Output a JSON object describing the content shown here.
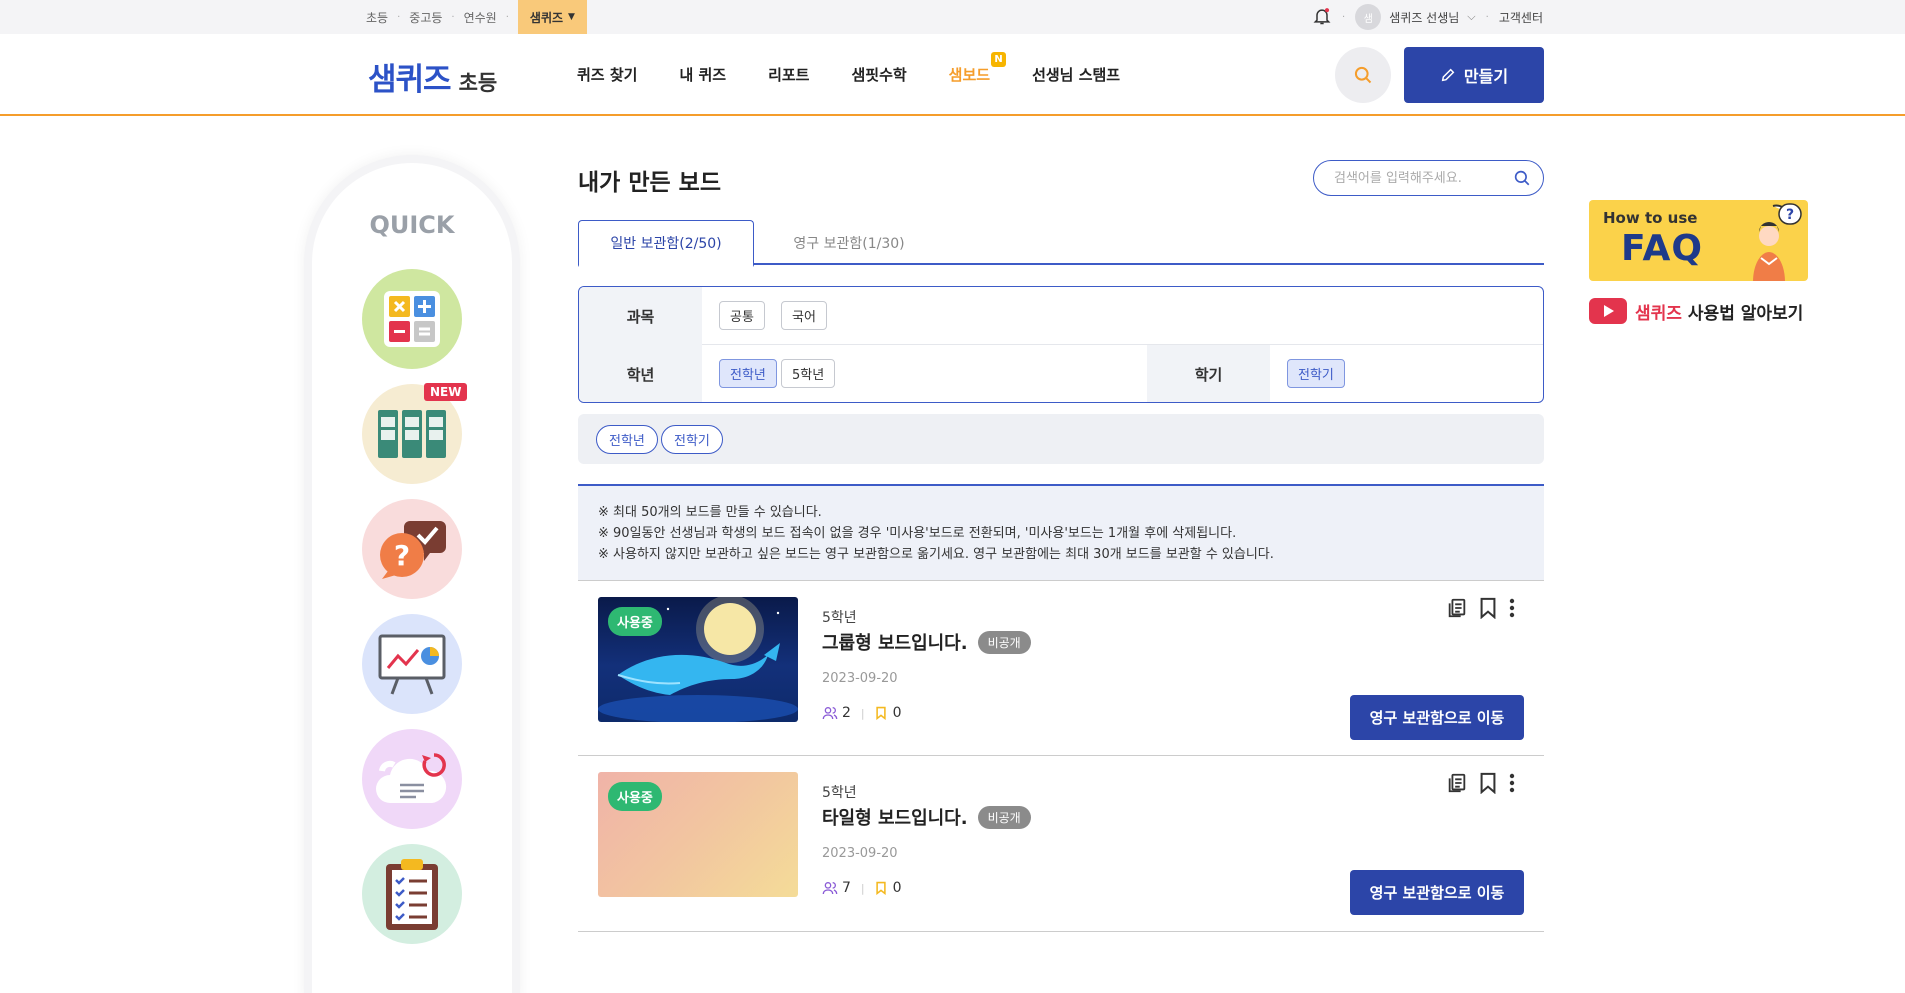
{
  "topbar": {
    "links": [
      "초등",
      "중고등",
      "연수원"
    ],
    "active_link": "샘퀴즈",
    "user_avatar_initial": "샘",
    "user_name": "샘퀴즈 선생님",
    "support": "고객센터"
  },
  "header": {
    "brand": "샘퀴즈",
    "brand_sub": "초등",
    "nav": [
      "퀴즈 찾기",
      "내 퀴즈",
      "리포트",
      "샘핏수학",
      "샘보드",
      "선생님 스탬프"
    ],
    "nav_badge": "N",
    "create_label": "만들기"
  },
  "quick": {
    "title": "QUICK",
    "new_label": "NEW"
  },
  "main": {
    "title": "내가 만든 보드",
    "search_placeholder": "검색어를 입력해주세요.",
    "tabs": [
      "일반 보관함(2/50)",
      "영구 보관함(1/30)"
    ],
    "filters": {
      "subject_label": "과목",
      "subject_options": [
        "공통",
        "국어"
      ],
      "grade_label": "학년",
      "grade_options": [
        "전학년",
        "5학년"
      ],
      "semester_label": "학기",
      "semester_options": [
        "전학기"
      ]
    },
    "selected_tags": [
      "전학년",
      "전학기"
    ],
    "notice": [
      "※ 최대 50개의 보드를 만들 수 있습니다.",
      "※ 90일동안 선생님과 학생의 보드 접속이 없을 경우 '미사용'보드로 전환되며, '미사용'보드는 1개월 후에 삭제됩니다.",
      "※ 사용하지 않지만 보관하고 싶은 보드는 영구 보관함으로 옮기세요. 영구 보관함에는 최대 30개 보드를 보관할 수 있습니다."
    ],
    "cards": [
      {
        "status": "사용중",
        "grade": "5학년",
        "title": "그룹형 보드입니다.",
        "visibility": "비공개",
        "date": "2023-09-20",
        "members": "2",
        "bookmarks": "0",
        "move_label": "영구 보관함으로 이동"
      },
      {
        "status": "사용중",
        "grade": "5학년",
        "title": "타일형 보드입니다.",
        "visibility": "비공개",
        "date": "2023-09-20",
        "members": "7",
        "bookmarks": "0",
        "move_label": "영구 보관함으로 이동"
      }
    ]
  },
  "side": {
    "faq_how": "How to use",
    "faq_big": "FAQ",
    "yt_brand": "샘퀴즈",
    "yt_text": "사용법 알아보기"
  },
  "colors": {
    "accent": "#2c45a8",
    "orange": "#f59d2b",
    "green": "#2eb872"
  }
}
